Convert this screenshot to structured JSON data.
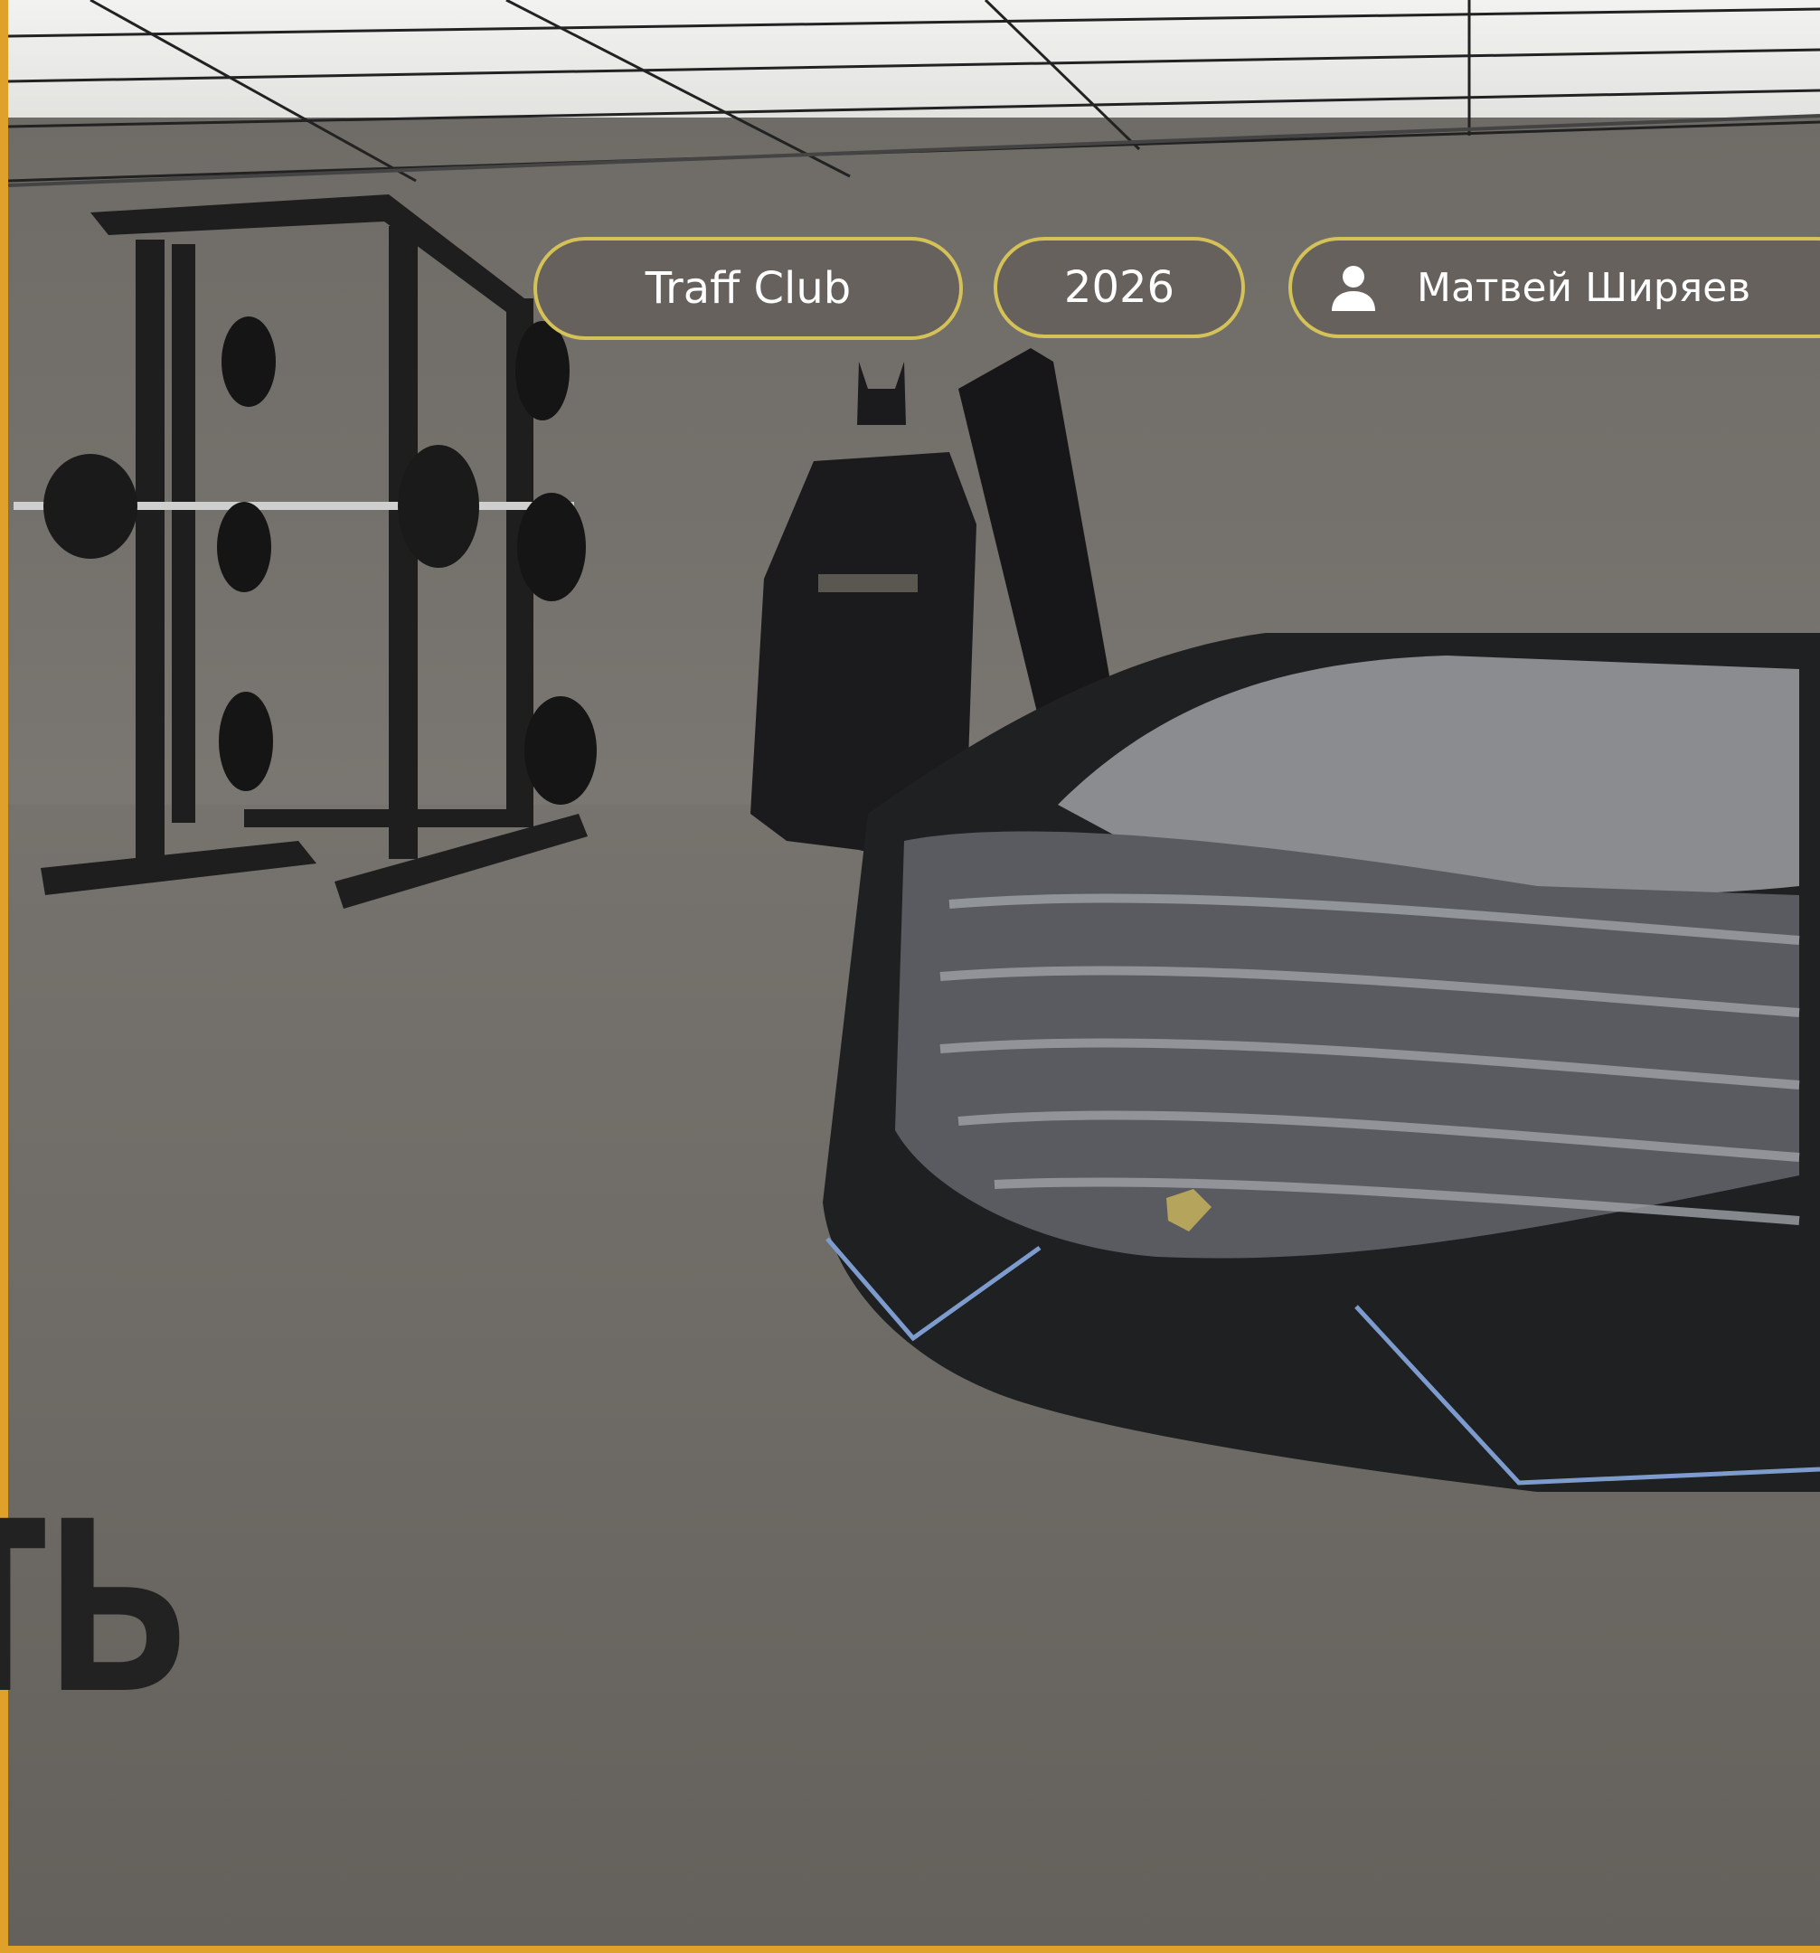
{
  "tags": {
    "club": "Traff Club",
    "year": "2026",
    "user_name": "Матвей Ширяев",
    "user_icon": "user-icon"
  },
  "headline": "ть",
  "colors": {
    "accent_border": "#e0a12a",
    "pill_border": "#d4c259",
    "headline": "#222222"
  }
}
